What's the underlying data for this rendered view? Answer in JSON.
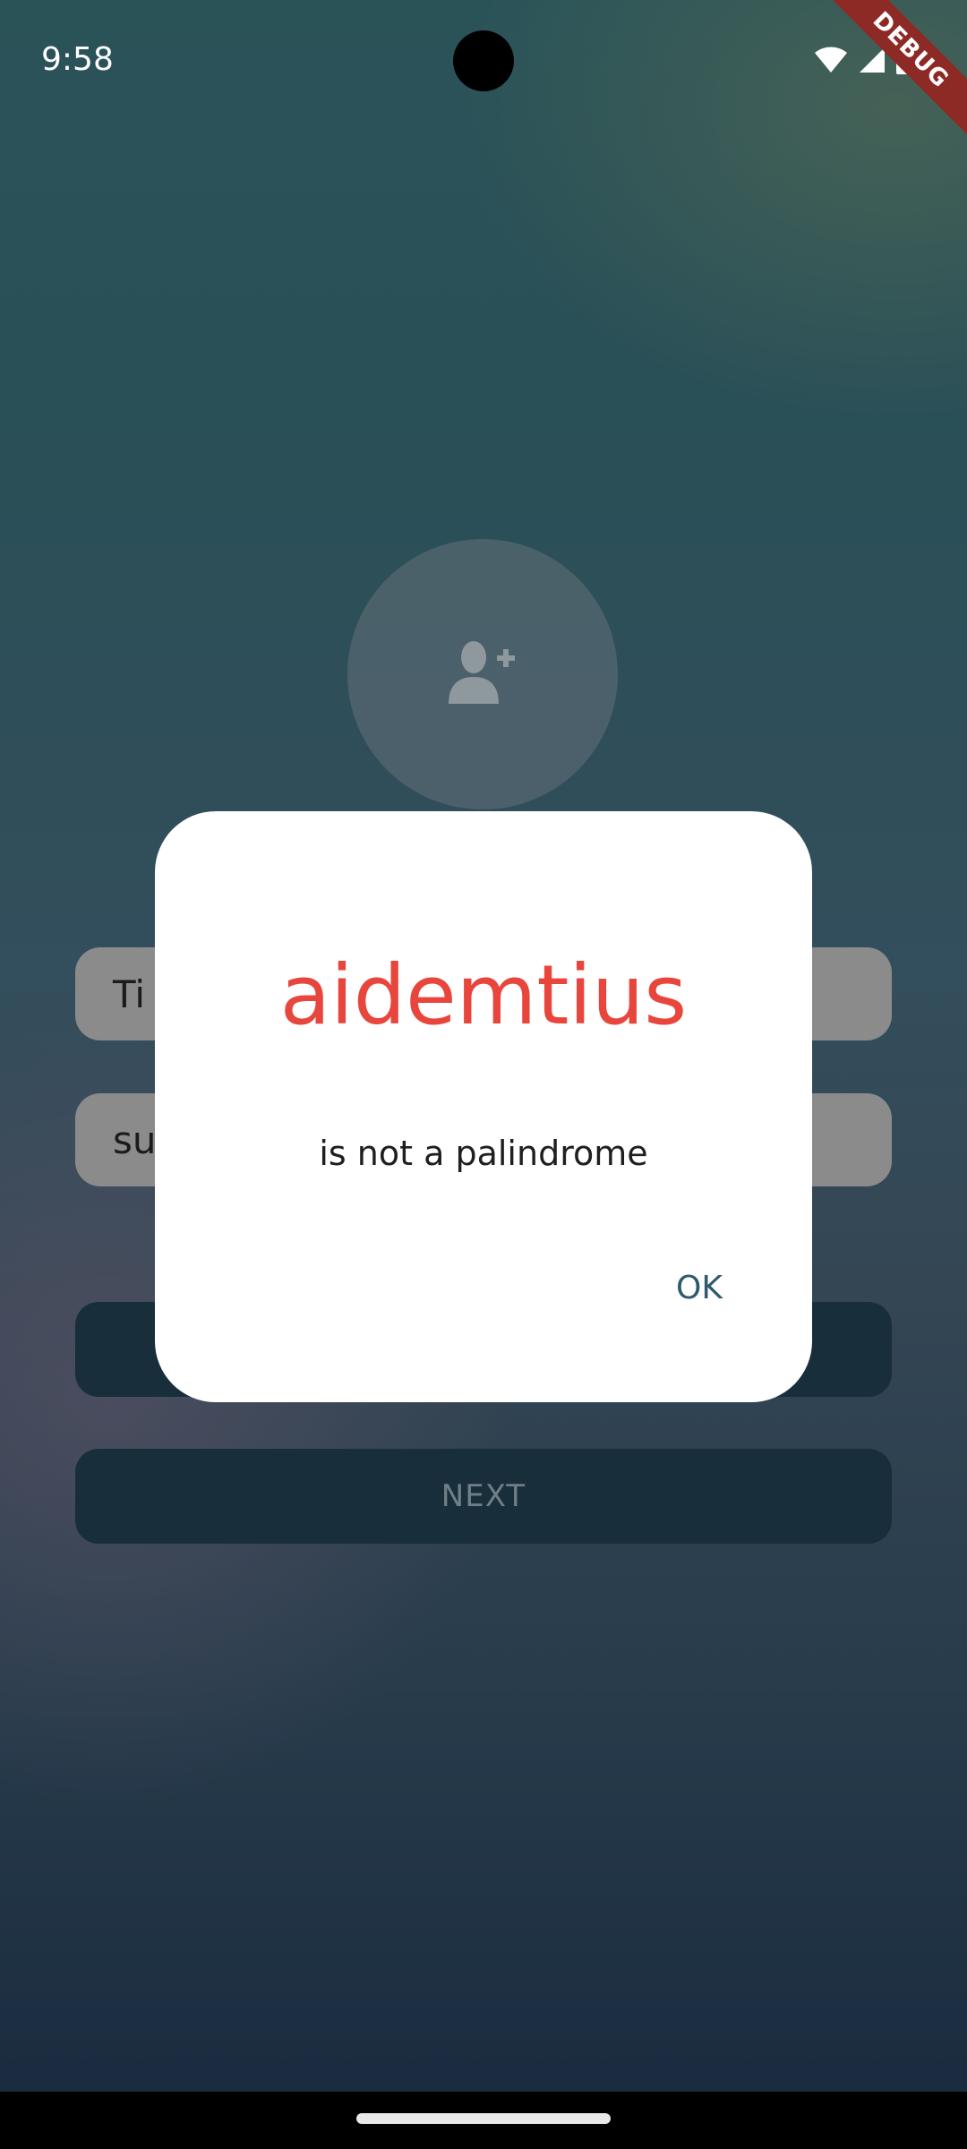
{
  "status_bar": {
    "time": "9:58",
    "icons": [
      "wifi-icon",
      "signal-icon",
      "battery-icon"
    ]
  },
  "debug_banner": "DEBUG",
  "avatar": {
    "icon": "add-user-icon"
  },
  "form": {
    "name_value": "Ti",
    "palindrome_value": "su"
  },
  "buttons": {
    "next_label": "NEXT"
  },
  "dialog": {
    "title": "aidemtius",
    "message": "is not a palindrome",
    "ok_label": "OK"
  },
  "colors": {
    "dialog_title": "#e8453c",
    "ok_text": "#2f5a6e",
    "button_bg": "#182e3b"
  }
}
